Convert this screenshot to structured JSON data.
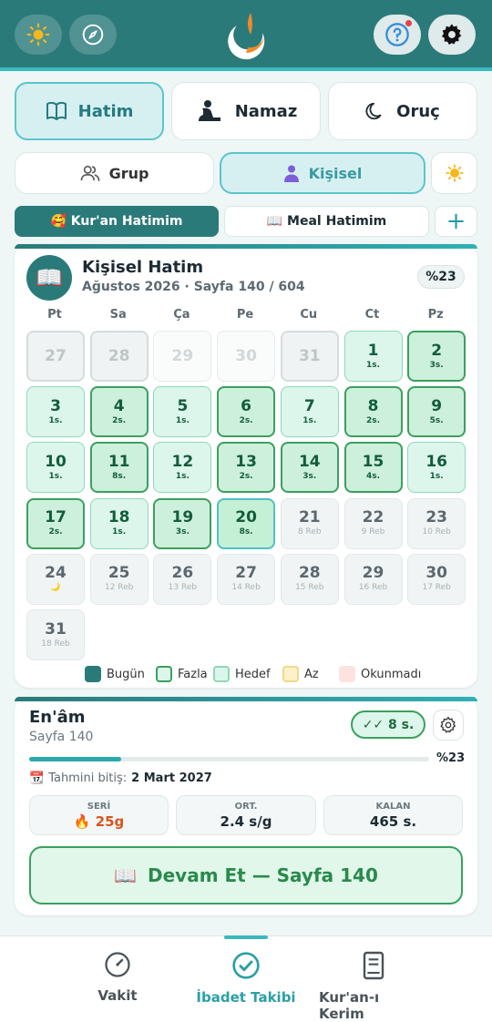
{
  "colors": {
    "header": "#2b7a7a",
    "accent": "#39b8bd",
    "fazla": "#3aa05e",
    "hedef": "#dcf6ec",
    "az": "#fff1c9",
    "okunmadi": "#fde3df",
    "bugun": "#2b7a7a"
  },
  "header": {
    "icons": [
      "sun-icon",
      "compass-icon",
      "logo-crescent",
      "help-icon",
      "gear-icon"
    ]
  },
  "modes": [
    {
      "label": "Hatim",
      "icon": "book-icon"
    },
    {
      "label": "Namaz",
      "icon": "prayer-icon"
    },
    {
      "label": "Oruç",
      "icon": "moon-icon"
    }
  ],
  "scope": [
    {
      "label": "Grup",
      "icon": "group-icon"
    },
    {
      "label": "Kişisel",
      "icon": "person-icon"
    }
  ],
  "subtabs": {
    "kuran": "🥰 Kur'an Hatimim",
    "meal": "📖 Meal Hatimim",
    "add": "+"
  },
  "hatim": {
    "title": "Kişisel Hatim",
    "subtitle": "Ağustos 2026 · Sayfa 140 / 604",
    "percent": "%23",
    "avatar": "📖"
  },
  "calendar": {
    "weekdays": [
      "Pt",
      "Sa",
      "Ça",
      "Pe",
      "Cu",
      "Ct",
      "Pz"
    ],
    "days": [
      {
        "n": "27",
        "s": "",
        "st": "past"
      },
      {
        "n": "28",
        "s": "",
        "st": "past"
      },
      {
        "n": "29",
        "s": "",
        "st": "pastempty"
      },
      {
        "n": "30",
        "s": "",
        "st": "pastempty"
      },
      {
        "n": "31",
        "s": "",
        "st": "past"
      },
      {
        "n": "1",
        "s": "1s.",
        "st": "hedef"
      },
      {
        "n": "2",
        "s": "3s.",
        "st": "fazla"
      },
      {
        "n": "3",
        "s": "1s.",
        "st": "hedef"
      },
      {
        "n": "4",
        "s": "2s.",
        "st": "fazla"
      },
      {
        "n": "5",
        "s": "1s.",
        "st": "hedef"
      },
      {
        "n": "6",
        "s": "2s.",
        "st": "fazla"
      },
      {
        "n": "7",
        "s": "1s.",
        "st": "hedef"
      },
      {
        "n": "8",
        "s": "2s.",
        "st": "fazla"
      },
      {
        "n": "9",
        "s": "5s.",
        "st": "fazla"
      },
      {
        "n": "10",
        "s": "1s.",
        "st": "hedef"
      },
      {
        "n": "11",
        "s": "8s.",
        "st": "fazla"
      },
      {
        "n": "12",
        "s": "1s.",
        "st": "hedef"
      },
      {
        "n": "13",
        "s": "2s.",
        "st": "fazla"
      },
      {
        "n": "14",
        "s": "3s.",
        "st": "fazla"
      },
      {
        "n": "15",
        "s": "4s.",
        "st": "fazla"
      },
      {
        "n": "16",
        "s": "1s.",
        "st": "hedef"
      },
      {
        "n": "17",
        "s": "2s.",
        "st": "fazla"
      },
      {
        "n": "18",
        "s": "1s.",
        "st": "hedef"
      },
      {
        "n": "19",
        "s": "3s.",
        "st": "fazla"
      },
      {
        "n": "20",
        "s": "8s.",
        "st": "today"
      },
      {
        "n": "21",
        "s": "8 Reb",
        "st": "future"
      },
      {
        "n": "22",
        "s": "9 Reb",
        "st": "future"
      },
      {
        "n": "23",
        "s": "10 Reb",
        "st": "future"
      },
      {
        "n": "24",
        "s": "🌙",
        "st": "future"
      },
      {
        "n": "25",
        "s": "12 Reb",
        "st": "future"
      },
      {
        "n": "26",
        "s": "13 Reb",
        "st": "future"
      },
      {
        "n": "27",
        "s": "14 Reb",
        "st": "future"
      },
      {
        "n": "28",
        "s": "15 Reb",
        "st": "future"
      },
      {
        "n": "29",
        "s": "16 Reb",
        "st": "future"
      },
      {
        "n": "30",
        "s": "17 Reb",
        "st": "future"
      },
      {
        "n": "31",
        "s": "18 Reb",
        "st": "future"
      }
    ],
    "legend": [
      {
        "label": "Bugün",
        "color": "#2b7a7a",
        "border": "#2b7a7a"
      },
      {
        "label": "Fazla",
        "color": "#dcf6ec",
        "border": "#3aa05e"
      },
      {
        "label": "Hedef",
        "color": "#dcf6ec",
        "border": "#8fd8b6"
      },
      {
        "label": "Az",
        "color": "#fff1c9",
        "border": "#f0d98a"
      },
      {
        "label": "Okunmadı",
        "color": "#fde3df",
        "border": "#fde3df"
      }
    ]
  },
  "progress": {
    "surah": "En'âm",
    "page": "Sayfa 140",
    "today": "✓✓ 8 s.",
    "fraction": 0.23,
    "percent": "%23",
    "eta_label": "Tahmini bitiş:",
    "eta_value": "2 Mart 2027",
    "calendar_emoji": "📆"
  },
  "stats": [
    {
      "label": "SERİ",
      "value": "🔥 25g"
    },
    {
      "label": "ORT.",
      "value": "2.4 s/g"
    },
    {
      "label": "KALAN",
      "value": "465 s."
    }
  ],
  "continue": {
    "icon": "📖",
    "label": "Devam Et — Sayfa 140"
  },
  "bottom_nav": [
    {
      "label": "Vakit",
      "icon": "clock-icon"
    },
    {
      "label": "İbadet Takibi",
      "icon": "check-circle-icon"
    },
    {
      "label": "Kur'an-ı Kerim",
      "icon": "quran-book-icon"
    }
  ]
}
